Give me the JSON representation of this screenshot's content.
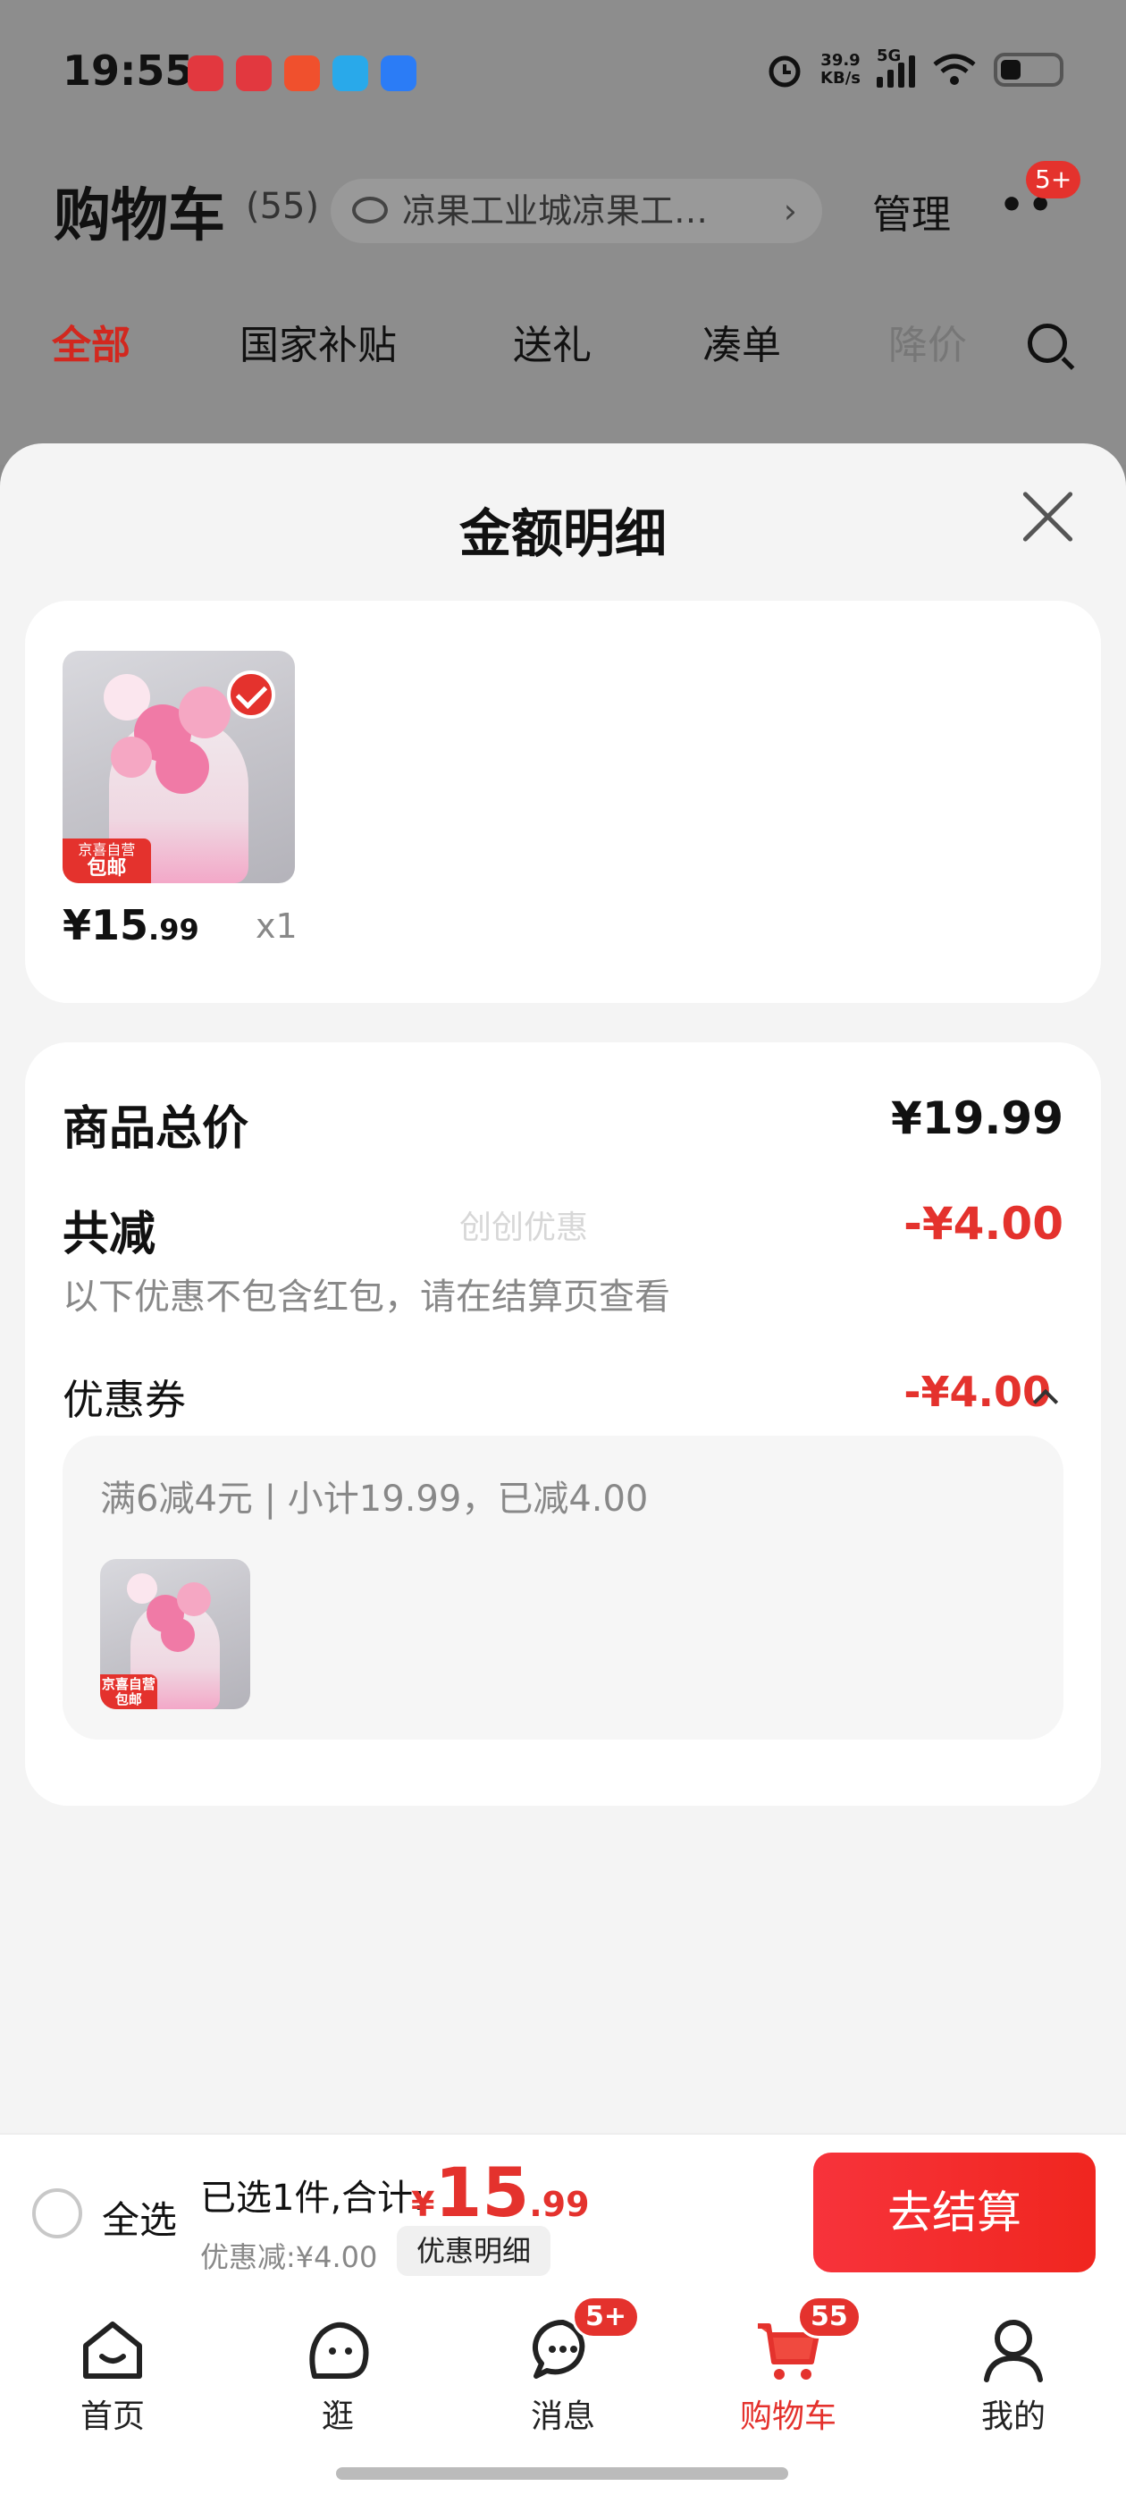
{
  "status_bar": {
    "time": "19:55",
    "app_icon_colors": [
      "#e2383f",
      "#e2383f",
      "#f0502d",
      "#29a9ea",
      "#2b7cf6"
    ],
    "net_speed_value": "39.9",
    "net_speed_unit": "KB/s",
    "network": "5G"
  },
  "background": {
    "title": "购物车",
    "count": "(55)",
    "address": "凉果工业城凉果工…",
    "manage": "管理",
    "more_badge": "5+",
    "tabs": [
      "全部",
      "国家补贴",
      "送礼",
      "凑单",
      "降价"
    ],
    "active_tab": "全部"
  },
  "sheet": {
    "title": "金额明细",
    "product": {
      "tag_line1": "京喜自营",
      "tag_line2": "包邮",
      "price_int": "¥15",
      "price_dec": ".99",
      "quantity": "x1"
    },
    "summary": {
      "total_label": "商品总价",
      "total_value": "¥19.99",
      "reduce_label": "共减",
      "reduce_value": "-¥4.00",
      "watermark": "创创优惠",
      "reduce_note": "以下优惠不包含红包，请在结算页查看",
      "coupon_label": "优惠券",
      "coupon_value": "-¥4.00",
      "coupon_detail": "满6减4元 | 小计19.99，已减4.00",
      "coupon_tag": "京喜自营 包邮"
    }
  },
  "checkout": {
    "select_all": "全选",
    "selected_text": "已选1件,合计:",
    "total_symbol": "¥",
    "total_int": "15",
    "total_dec": ".99",
    "discount": "优惠减:¥4.00",
    "detail_button": "优惠明细",
    "checkout_button": "去结算"
  },
  "nav": {
    "items": [
      {
        "label": "首页",
        "icon": "home-icon"
      },
      {
        "label": "逛",
        "icon": "explore-icon"
      },
      {
        "label": "消息",
        "icon": "message-icon",
        "badge": "5+"
      },
      {
        "label": "购物车",
        "icon": "cart-icon",
        "badge": "55",
        "active": true
      },
      {
        "label": "我的",
        "icon": "profile-icon"
      }
    ]
  },
  "colors": {
    "accent": "#e4322d",
    "checkout_button": "#f7333b"
  }
}
